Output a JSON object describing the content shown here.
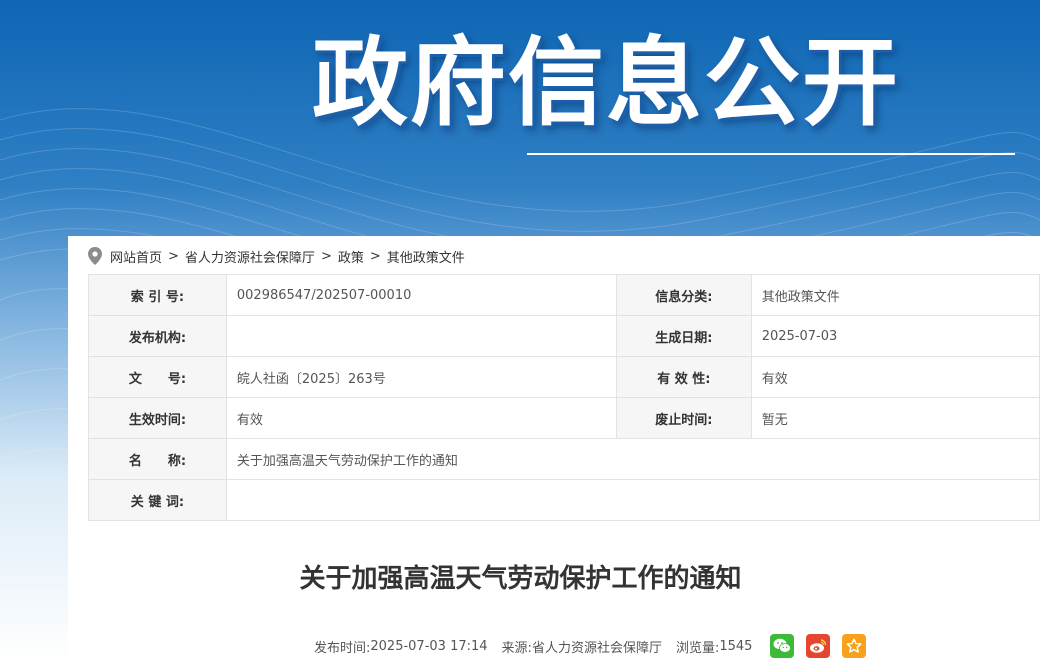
{
  "banner": {
    "title": "政府信息公开"
  },
  "breadcrumb": {
    "items": [
      "网站首页",
      "省人力资源社会保障厅",
      "政策",
      "其他政策文件"
    ],
    "separator": ">"
  },
  "meta": {
    "index_no_label": "索 引 号:",
    "index_no_value": "002986547/202507-00010",
    "category_label": "信息分类:",
    "category_value": "其他政策文件",
    "publisher_label": "发布机构:",
    "publisher_value": "",
    "created_label": "生成日期:",
    "created_value": "2025-07-03",
    "doc_no_label": "文　　号:",
    "doc_no_value": "皖人社函〔2025〕263号",
    "validity_label": "有 效 性:",
    "validity_value": "有效",
    "effective_label": "生效时间:",
    "effective_value": "有效",
    "repeal_label": "废止时间:",
    "repeal_value": "暂无",
    "name_label": "名　　称:",
    "name_value": "关于加强高温天气劳动保护工作的通知",
    "keywords_label": "关 键 词:",
    "keywords_value": ""
  },
  "article": {
    "title": "关于加强高温天气劳动保护工作的通知",
    "publish_time_label": "发布时间:",
    "publish_time": "2025-07-03 17:14",
    "source_label": "来源:",
    "source": "省人力资源社会保障厅",
    "views_label": "浏览量:",
    "views": "1545"
  },
  "share": {
    "icons": [
      "wechat-icon",
      "weibo-icon",
      "favorite-icon"
    ]
  },
  "colors": {
    "banner_blue": "#0e66b4",
    "wechat": "#3dba3a",
    "weibo": "#e6452e",
    "favorite": "#f7a21a"
  }
}
